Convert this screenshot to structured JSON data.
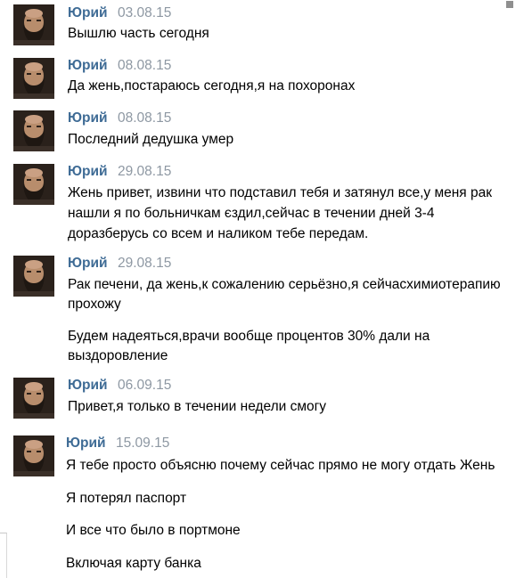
{
  "colors": {
    "author": "#3e6b95",
    "date": "#8e98a3",
    "text": "#000000",
    "background": "#ffffff"
  },
  "messages": [
    {
      "author": "Юрий",
      "date": "03.08.15",
      "avatar_icon": "bearded-man-avatar",
      "lines": [
        "Вышлю часть сегодня"
      ]
    },
    {
      "author": "Юрий",
      "date": "08.08.15",
      "avatar_icon": "bearded-man-avatar",
      "lines": [
        "Да жень,постараюсь сегодня,я на похоронах"
      ]
    },
    {
      "author": "Юрий",
      "date": "08.08.15",
      "avatar_icon": "bearded-man-avatar",
      "lines": [
        "Последний дедушка умер"
      ]
    },
    {
      "author": "Юрий",
      "date": "29.08.15",
      "avatar_icon": "bearded-man-avatar",
      "lines": [
        "Жень привет, извини что подставил тебя и затянул все,у меня рак",
        "нашли я по больничкам єздил,сейчас в течении дней 3-4",
        "доразберусь со всем и наликом тебе передам."
      ]
    },
    {
      "author": "Юрий",
      "date": "29.08.15",
      "avatar_icon": "bearded-man-avatar",
      "lines": [
        "Рак печени, да жень,к сожалению серьёзно,я сейчасхимиотерапию",
        "прохожу",
        "Будем надеяться,врачи вообще процентов 30% дали на",
        "выздоровление"
      ]
    },
    {
      "author": "Юрий",
      "date": "06.09.15",
      "avatar_icon": "bearded-man-avatar",
      "lines": [
        "Привет,я только в течении недели смогу"
      ]
    },
    {
      "author": "Юрий",
      "date": "15.09.15",
      "avatar_icon": "bearded-man-avatar",
      "lines": [
        "Я тебе просто объясню почему сейчас прямо не могу отдать Жень",
        "Я потерял паспорт",
        "И все что было в портмоне",
        "Включая карту банка"
      ]
    }
  ]
}
